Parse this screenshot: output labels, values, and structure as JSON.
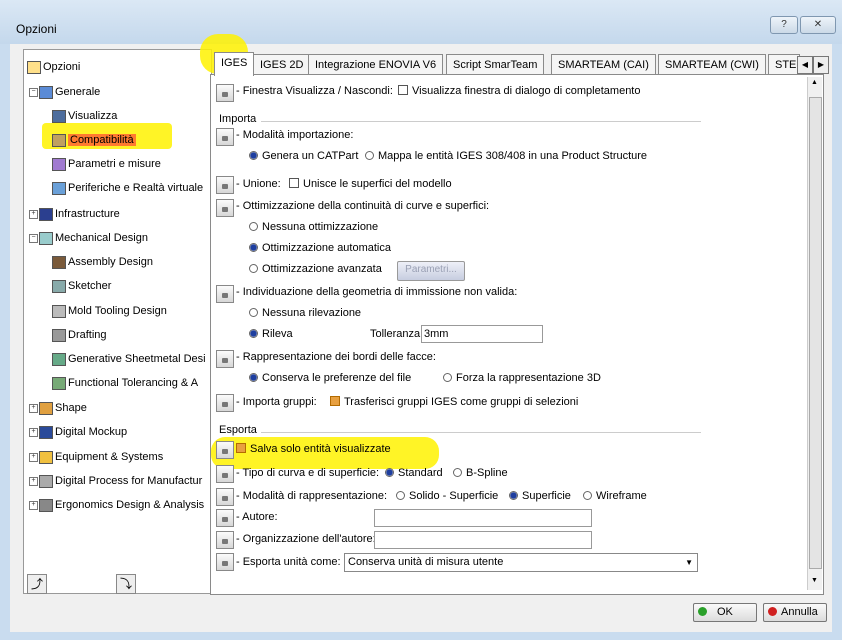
{
  "window": {
    "title": "Opzioni",
    "help_label": "?",
    "close_label": "✕"
  },
  "tree": {
    "items": [
      {
        "label": "Opzioni"
      },
      {
        "label": "Generale"
      },
      {
        "label": "Visualizza"
      },
      {
        "label": "Compatibilità"
      },
      {
        "label": "Parametri e misure"
      },
      {
        "label": "Periferiche e Realtà virtuale"
      },
      {
        "label": "Infrastructure"
      },
      {
        "label": "Mechanical Design"
      },
      {
        "label": "Assembly Design"
      },
      {
        "label": "Sketcher"
      },
      {
        "label": "Mold Tooling Design"
      },
      {
        "label": "Drafting"
      },
      {
        "label": "Generative Sheetmetal Desi"
      },
      {
        "label": "Functional Tolerancing & A"
      },
      {
        "label": "Shape"
      },
      {
        "label": "Digital Mockup"
      },
      {
        "label": "Equipment & Systems"
      },
      {
        "label": "Digital Process for Manufactur"
      },
      {
        "label": "Ergonomics Design & Analysis"
      }
    ]
  },
  "tabs": [
    "IGES",
    "IGES 2D",
    "Integrazione ENOVIA V6",
    "Script SmarTeam",
    "SMARTEAM (CAI)",
    "SMARTEAM (CWI)",
    "STE"
  ],
  "panel": {
    "finestra": {
      "label": "- Finestra Visualizza / Nascondi:",
      "check_label": "Visualizza finestra di dialogo di completamento"
    },
    "importa_title": "Importa",
    "modalita": {
      "label": "- Modalità importazione:",
      "opt1": "Genera un CATPart",
      "opt2": "Mappa le entità IGES 308/408 in una Product Structure"
    },
    "unione": {
      "label": "- Unione:",
      "check_label": "Unisce le superfici del modello"
    },
    "ottimizzazione": {
      "label": "- Ottimizzazione della continuità di curve e superfici:",
      "opt1": "Nessuna ottimizzazione",
      "opt2": "Ottimizzazione automatica",
      "opt3": "Ottimizzazione avanzata",
      "button": "Parametri..."
    },
    "individuazione": {
      "label": "- Individuazione della geometria di immissione non valida:",
      "opt1": "Nessuna rilevazione",
      "opt2": "Rileva",
      "toll_label": "Tolleranza:",
      "toll_value": "3mm"
    },
    "bordi": {
      "label": "- Rappresentazione dei bordi delle facce:",
      "opt1": "Conserva le preferenze del file",
      "opt2": "Forza la rappresentazione 3D"
    },
    "gruppi": {
      "label": "- Importa gruppi:",
      "check_label": "Trasferisci gruppi IGES come gruppi di selezioni"
    },
    "esporta_title": "Esporta",
    "salva": {
      "check_label": "Salva solo entità visualizzate"
    },
    "tipo": {
      "label": "- Tipo di curva e di superficie:",
      "opt1": "Standard",
      "opt2": "B-Spline"
    },
    "rappresentazione": {
      "label": "- Modalità di rappresentazione:",
      "opt1": "Solido - Superficie",
      "opt2": "Superficie",
      "opt3": "Wireframe"
    },
    "autore": {
      "label": "- Autore:",
      "value": ""
    },
    "organizzazione": {
      "label": "- Organizzazione dell'autore:",
      "value": ""
    },
    "unita": {
      "label": "- Esporta unità come:",
      "value": "Conserva unità di misura utente"
    }
  },
  "buttons": {
    "ok": "OK",
    "cancel": "Annulla"
  },
  "colors": {
    "highlight": "#fff200",
    "selected": "#ff7a30",
    "ok_dot": "#2aa02a",
    "cancel_dot": "#d02020"
  }
}
